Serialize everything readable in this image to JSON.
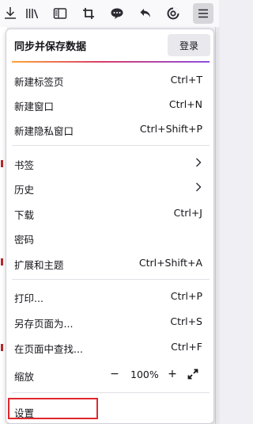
{
  "toolbar": {
    "icons": [
      "download-icon",
      "library-icon",
      "sidebar-icon",
      "screenshot-icon",
      "chat-icon",
      "undo-icon",
      "extension-icon",
      "menu-icon"
    ]
  },
  "sync": {
    "title": "同步并保存数据",
    "login_label": "登录"
  },
  "menu": {
    "new_tab": {
      "label": "新建标签页",
      "shortcut": "Ctrl+T"
    },
    "new_window": {
      "label": "新建窗口",
      "shortcut": "Ctrl+N"
    },
    "new_private": {
      "label": "新建隐私窗口",
      "shortcut": "Ctrl+Shift+P"
    },
    "bookmarks": {
      "label": "书签"
    },
    "history": {
      "label": "历史"
    },
    "downloads": {
      "label": "下载",
      "shortcut": "Ctrl+J"
    },
    "passwords": {
      "label": "密码"
    },
    "addons": {
      "label": "扩展和主题",
      "shortcut": "Ctrl+Shift+A"
    },
    "print": {
      "label": "打印...",
      "shortcut": "Ctrl+P"
    },
    "save_as": {
      "label": "另存页面为...",
      "shortcut": "Ctrl+S"
    },
    "find": {
      "label": "在页面中查找...",
      "shortcut": "Ctrl+F"
    },
    "zoom": {
      "label": "缩放",
      "minus": "−",
      "value": "100%",
      "plus": "+"
    },
    "settings": {
      "label": "设置"
    }
  },
  "colors": {
    "highlight_box": "#e0282e",
    "accent_gradient": [
      "#ffa436",
      "#d83e6c",
      "#8e4ee0"
    ]
  }
}
